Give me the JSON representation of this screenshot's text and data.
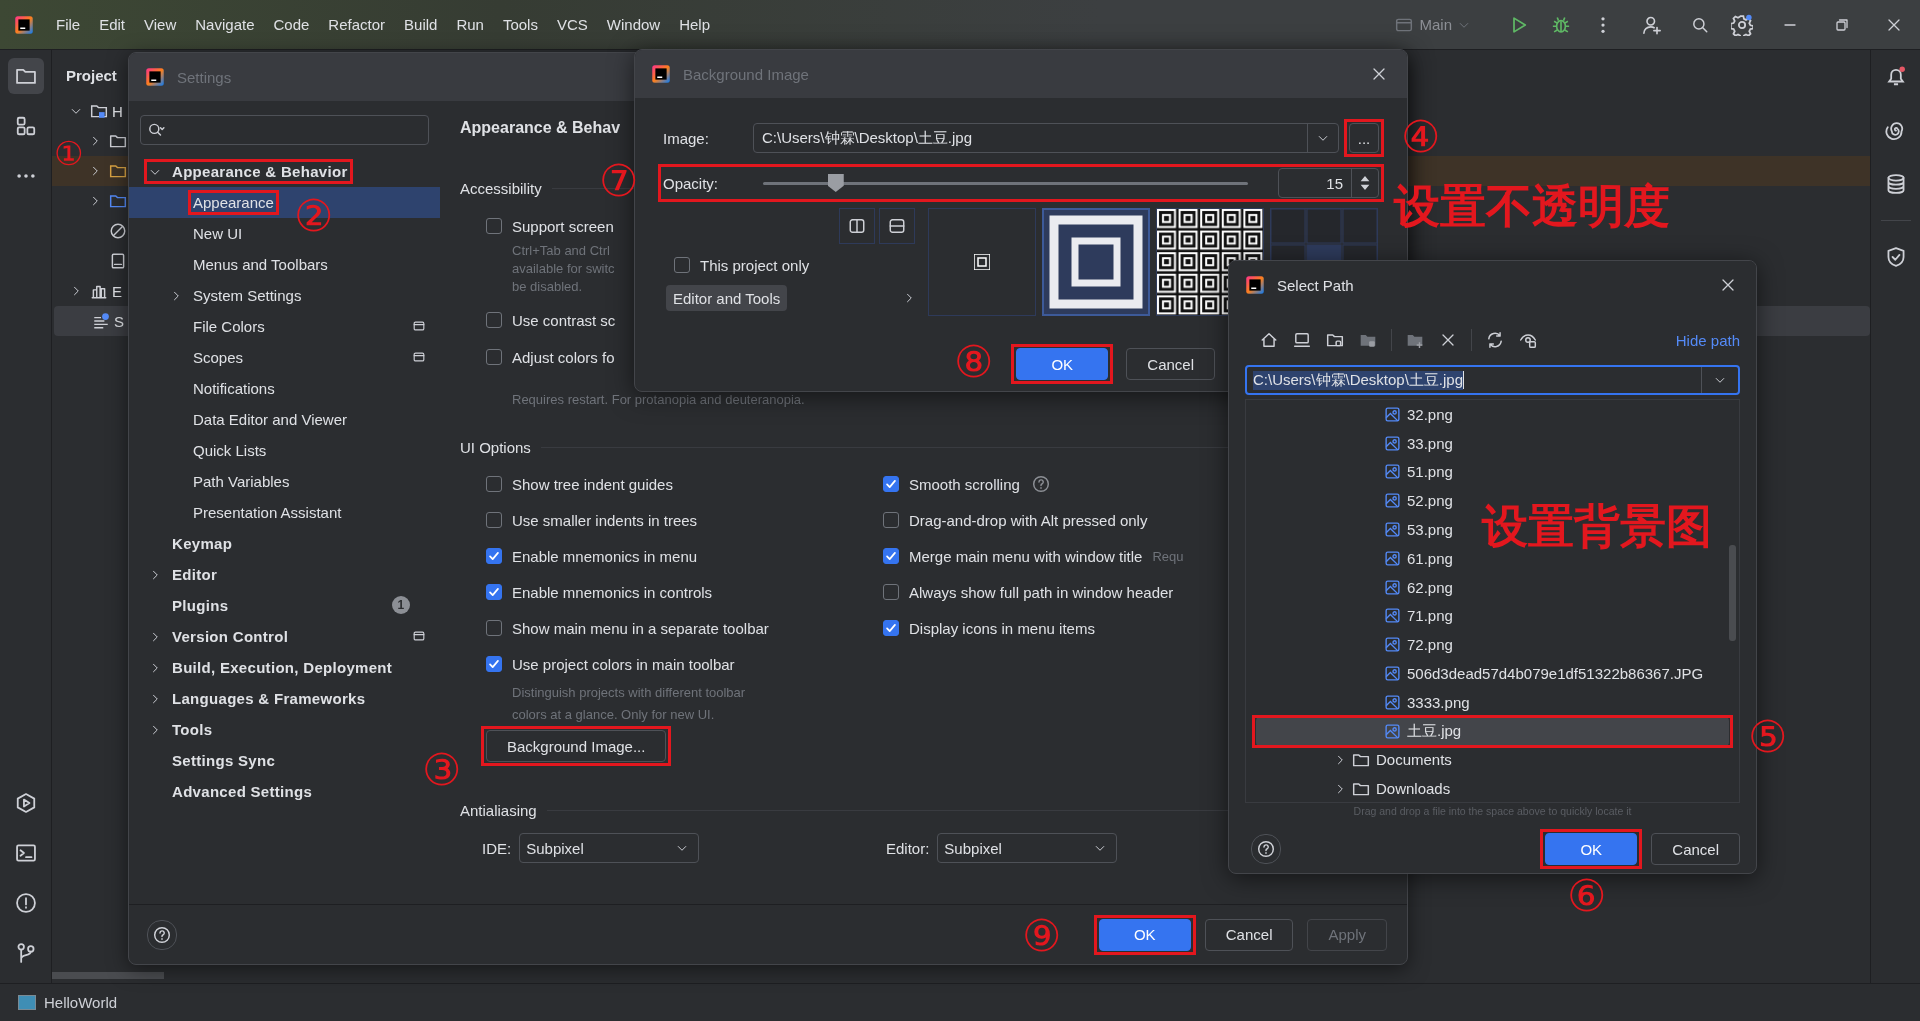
{
  "menu_bar": {
    "items": [
      "File",
      "Edit",
      "View",
      "Navigate",
      "Code",
      "Refactor",
      "Build",
      "Run",
      "Tools",
      "VCS",
      "Window",
      "Help"
    ],
    "run_config": "Main"
  },
  "project_panel": {
    "title": "Project",
    "tree": [
      {
        "kind": "module",
        "label": "H",
        "expanded": true,
        "selected": false,
        "children": [
          {
            "kind": "folder",
            "expanded": false,
            "selected": false
          },
          {
            "kind": "resource-folder",
            "expanded": false,
            "selected": false
          },
          {
            "kind": "source-folder",
            "expanded": false,
            "selected": false
          },
          {
            "kind": "ignore-file",
            "selected": false
          },
          {
            "kind": "file",
            "selected": false
          }
        ]
      },
      {
        "kind": "libraries",
        "label": "E",
        "expanded": false,
        "selected": false
      },
      {
        "kind": "scratches",
        "label": "S",
        "selected": true
      }
    ]
  },
  "settings": {
    "title": "Settings",
    "sidebar": [
      {
        "label": "Appearance & Behavior",
        "expanded": true,
        "selected": false,
        "framed": true,
        "callout": "①",
        "children": [
          {
            "label": "Appearance",
            "selected": true,
            "framed": true,
            "callout": "②"
          },
          {
            "label": "New UI",
            "selected": false
          },
          {
            "label": "Menus and Toolbars",
            "selected": false
          },
          {
            "label": "System Settings",
            "expanded": false,
            "selected": false
          },
          {
            "label": "File Colors",
            "selected": false,
            "project_level": true
          },
          {
            "label": "Scopes",
            "selected": false,
            "project_level": true
          },
          {
            "label": "Notifications",
            "selected": false
          },
          {
            "label": "Data Editor and Viewer",
            "selected": false
          },
          {
            "label": "Quick Lists",
            "selected": false
          },
          {
            "label": "Path Variables",
            "selected": false
          },
          {
            "label": "Presentation Assistant",
            "selected": false
          }
        ]
      },
      {
        "label": "Keymap",
        "selected": false
      },
      {
        "label": "Editor",
        "expanded": false,
        "selected": false
      },
      {
        "label": "Plugins",
        "selected": false,
        "badge": "1"
      },
      {
        "label": "Version Control",
        "expanded": false,
        "selected": false,
        "project_level": true
      },
      {
        "label": "Build, Execution, Deployment",
        "expanded": false,
        "selected": false
      },
      {
        "label": "Languages & Frameworks",
        "expanded": false,
        "selected": false
      },
      {
        "label": "Tools",
        "expanded": false,
        "selected": false
      },
      {
        "label": "Settings Sync",
        "selected": false
      },
      {
        "label": "Advanced Settings",
        "selected": false
      }
    ],
    "heading": "Appearance & Behav",
    "accessibility": {
      "title": "Accessibility",
      "options": [
        {
          "label": "Support screen",
          "checked": false,
          "description_lines": [
            "Ctrl+Tab and Ctrl",
            "available for switc",
            "be disabled."
          ]
        },
        {
          "label": "Use contrast sc",
          "checked": false
        },
        {
          "label": "Adjust colors fo",
          "checked": false,
          "description_lines": [
            "Requires restart. For protanopia and deuteranopia."
          ]
        }
      ]
    },
    "ui_options": {
      "title": "UI Options",
      "columns": [
        [
          {
            "label": "Show tree indent guides",
            "checked": false
          },
          {
            "label": "Use smaller indents in trees",
            "checked": false
          },
          {
            "label": "Enable mnemonics in menu",
            "checked": true
          },
          {
            "label": "Enable mnemonics in controls",
            "checked": true
          },
          {
            "label": "Show main menu in a separate toolbar",
            "checked": false
          },
          {
            "label": "Use project colors in main toolbar",
            "checked": true,
            "description": "Distinguish projects with different toolbar colors at a glance. Only for new UI."
          }
        ],
        [
          {
            "label": "Smooth scrolling",
            "checked": true,
            "help_icon": true
          },
          {
            "label": "Drag-and-drop with Alt pressed only",
            "checked": false
          },
          {
            "label": "Merge main menu with window title",
            "checked": true,
            "hint": "Requ"
          },
          {
            "label": "Always show full path in window header",
            "checked": false
          },
          {
            "label": "Display icons in menu items",
            "checked": true
          }
        ]
      ],
      "background_button": {
        "label": "Background Image...",
        "framed": true,
        "callout": "③"
      }
    },
    "antialiasing": {
      "title": "Antialiasing",
      "fields": [
        {
          "label": "IDE:",
          "value": "Subpixel"
        },
        {
          "label": "Editor:",
          "value": "Subpixel"
        }
      ]
    },
    "buttons": [
      {
        "label": "OK",
        "kind": "primary",
        "disabled": false,
        "framed": true,
        "callout": "⑨"
      },
      {
        "label": "Cancel",
        "kind": "default",
        "disabled": false,
        "framed": false
      },
      {
        "label": "Apply",
        "kind": "default",
        "disabled": true,
        "framed": false
      }
    ]
  },
  "background_image_dialog": {
    "title": "Background Image",
    "image": {
      "label": "Image:",
      "value": "C:\\Users\\钟霖\\Desktop\\土豆.jpg"
    },
    "browse_button": {
      "label": "...",
      "framed": true,
      "callout": "④"
    },
    "opacity": {
      "label": "Opacity:",
      "level": 0.15,
      "value": "15",
      "framed": true,
      "callout": "⑦",
      "caption": "设置不透明度"
    },
    "this_project_only": {
      "label": "This project only",
      "checked": false
    },
    "target": {
      "label": "Editor and Tools"
    },
    "fill_modes": [
      {
        "kind": "center",
        "selected": false
      },
      {
        "kind": "scale",
        "selected": true
      },
      {
        "kind": "tile",
        "selected": false
      },
      {
        "kind": "anchor",
        "selected": false
      }
    ],
    "buttons": [
      {
        "label": "OK",
        "kind": "primary",
        "framed": true,
        "callout": "⑧"
      },
      {
        "label": "Cancel",
        "kind": "default",
        "framed": false
      }
    ]
  },
  "select_path": {
    "title": "Select Path",
    "hide_path": "Hide path",
    "path": "C:\\Users\\钟霖\\Desktop\\土豆.jpg",
    "files": [
      {
        "kind": "image",
        "label": "32.png",
        "selected": false
      },
      {
        "kind": "image",
        "label": "33.png",
        "selected": false
      },
      {
        "kind": "image",
        "label": "51.png",
        "selected": false
      },
      {
        "kind": "image",
        "label": "52.png",
        "selected": false
      },
      {
        "kind": "image",
        "label": "53.png",
        "selected": false
      },
      {
        "kind": "image",
        "label": "61.png",
        "selected": false
      },
      {
        "kind": "image",
        "label": "62.png",
        "selected": false
      },
      {
        "kind": "image",
        "label": "71.png",
        "selected": false
      },
      {
        "kind": "image",
        "label": "72.png",
        "selected": false
      },
      {
        "kind": "image",
        "label": "506d3dead57d4b079e1df51322b86367.JPG",
        "selected": false
      },
      {
        "kind": "image",
        "label": "3333.png",
        "selected": false
      },
      {
        "kind": "image",
        "label": "土豆.jpg",
        "selected": true,
        "framed": true,
        "callout": "⑤"
      },
      {
        "kind": "folder",
        "label": "Documents",
        "selected": false,
        "expanded": false
      },
      {
        "kind": "folder",
        "label": "Downloads",
        "selected": false,
        "expanded": false
      }
    ],
    "caption": "设置背景图",
    "hint": "Drag and drop a file into the space above to quickly locate it",
    "buttons": [
      {
        "label": "OK",
        "kind": "primary",
        "framed": true,
        "callout": "⑥"
      },
      {
        "label": "Cancel",
        "kind": "default",
        "framed": false
      }
    ]
  },
  "status_bar": {
    "project": "HelloWorld"
  }
}
